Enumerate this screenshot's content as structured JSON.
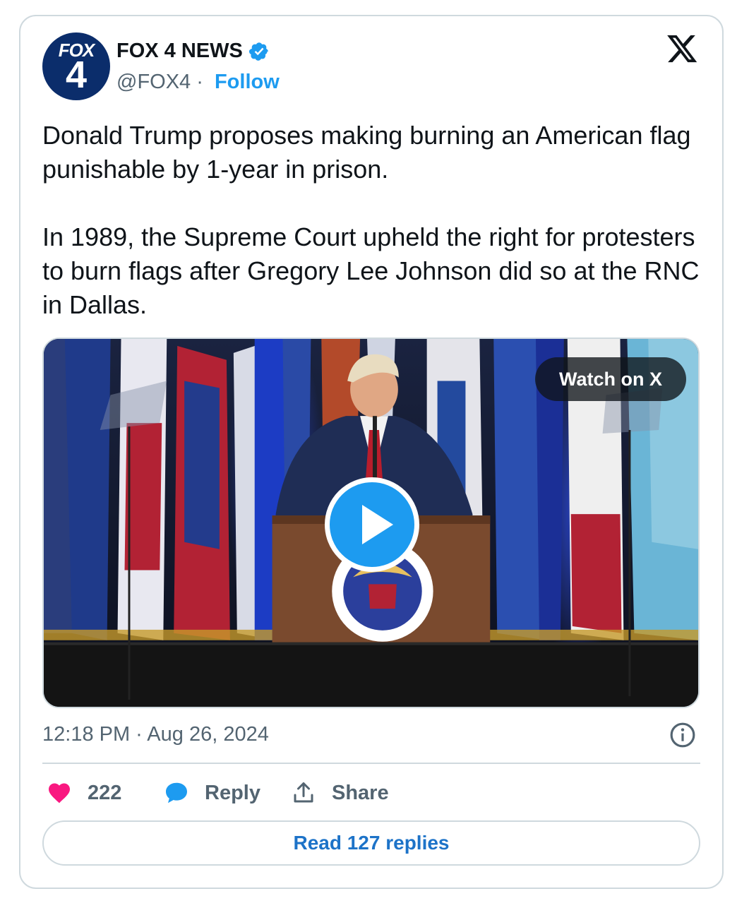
{
  "author": {
    "avatar_text_top": "FOX",
    "avatar_text_bottom": "4",
    "name": "FOX 4 NEWS",
    "handle": "@FOX4",
    "separator": " · ",
    "follow_label": "Follow",
    "verified": true
  },
  "platform_logo": "x-logo-icon",
  "tweet": {
    "paragraphs": [
      "Donald Trump proposes making burning an American flag punishable by 1-year in prison.",
      "In 1989, the Supreme Court upheld the right for protesters to burn flags after Gregory Lee Johnson did so at the RNC in Dallas."
    ]
  },
  "media": {
    "type": "video",
    "watch_label": "Watch on X",
    "play_icon": "play-icon"
  },
  "timestamp": "12:18 PM · Aug 26, 2024",
  "actions": {
    "like_count": "222",
    "reply_label": "Reply",
    "share_label": "Share"
  },
  "read_replies_label": "Read 127 replies",
  "colors": {
    "accent": "#1d9bf0",
    "like": "#f91880",
    "text": "#0f1419",
    "muted": "#536471",
    "border": "#cfd9de"
  }
}
